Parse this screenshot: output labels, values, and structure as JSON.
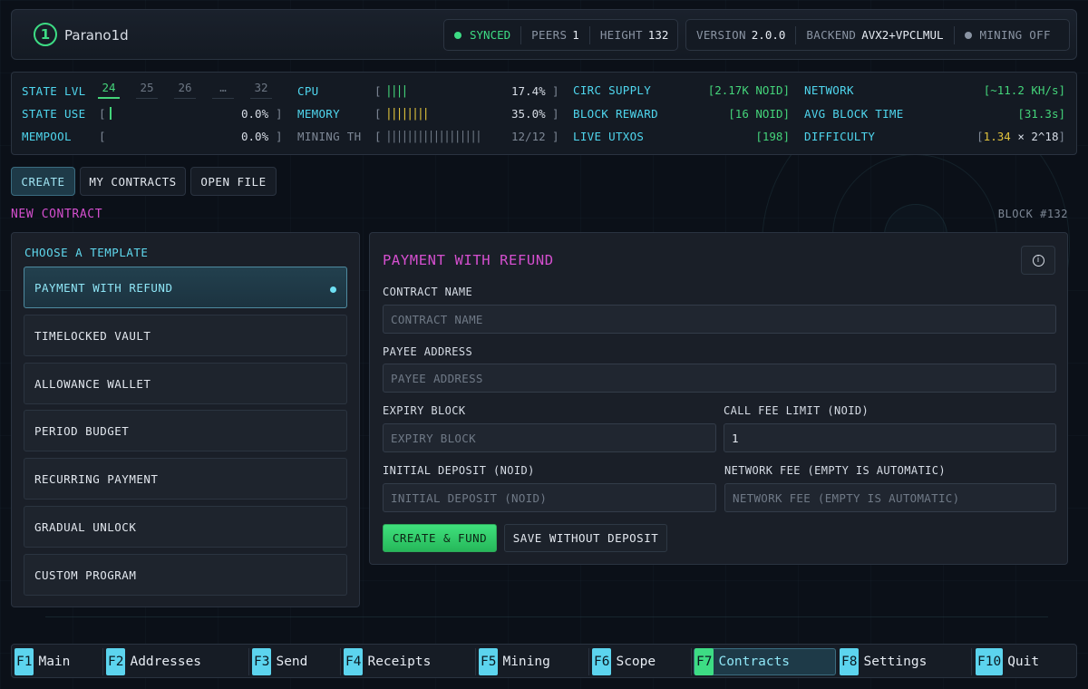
{
  "header": {
    "app_name": "Parano1d",
    "logo_glyph": "1",
    "sync_status": "SYNCED",
    "peers_label": "PEERS",
    "peers_value": "1",
    "height_label": "HEIGHT",
    "height_value": "132",
    "version_label": "VERSION",
    "version_value": "2.0.0",
    "backend_label": "BACKEND",
    "backend_value": "AVX2+VPCLMUL",
    "mining_status": "MINING OFF",
    "colors": {
      "synced": "#3ddc84",
      "mining_off": "#8a94a3"
    }
  },
  "stats": {
    "state_lvl_label": "STATE LVL",
    "state_levels": [
      "24",
      "25",
      "26",
      "…",
      "32"
    ],
    "state_use_label": "STATE USE",
    "state_use_value": "0.0%",
    "mempool_label": "MEMPOOL",
    "mempool_value": "0.0%",
    "cpu_label": "CPU",
    "cpu_bars": "||||",
    "cpu_value": "17.4%",
    "memory_label": "MEMORY",
    "memory_bars": "||||||||",
    "memory_value": "35.0%",
    "mining_th_label": "MINING TH",
    "mining_th_bars": "||||||||||||||||||",
    "mining_th_value": "12/12",
    "circ_supply_label": "CIRC SUPPLY",
    "circ_supply_value": "[2.17K NOID]",
    "block_reward_label": "BLOCK REWARD",
    "block_reward_value": "[16 NOID]",
    "live_utxos_label": "LIVE UTXOS",
    "live_utxos_value": "[198]",
    "network_label": "NETWORK",
    "network_value": "[~11.2 KH/s]",
    "avg_block_time_label": "AVG BLOCK TIME",
    "avg_block_time_value": "[31.3s]",
    "difficulty_label": "DIFFICULTY",
    "difficulty_mantissa": "1.34",
    "difficulty_exp": "× 2^18",
    "colors": {
      "cpu_bar": "#44d47a",
      "memory_bar": "#e0c23c",
      "mining_bar": "#6c7683",
      "label": "#4fd6ee"
    }
  },
  "tabs": [
    {
      "label": "CREATE"
    },
    {
      "label": "MY CONTRACTS"
    },
    {
      "label": "OPEN FILE"
    }
  ],
  "section": {
    "title": "NEW CONTRACT",
    "block": "BLOCK #132"
  },
  "templates": {
    "title": "CHOOSE A TEMPLATE",
    "items": [
      "PAYMENT WITH REFUND",
      "TIMELOCKED VAULT",
      "ALLOWANCE WALLET",
      "PERIOD BUDGET",
      "RECURRING PAYMENT",
      "GRADUAL UNLOCK",
      "CUSTOM PROGRAM"
    ],
    "selected": "PAYMENT WITH REFUND"
  },
  "form": {
    "title": "PAYMENT WITH REFUND",
    "info_icon": "info-icon",
    "contract_name_label": "CONTRACT NAME",
    "contract_name_placeholder": "CONTRACT NAME",
    "payee_label": "PAYEE ADDRESS",
    "payee_placeholder": "PAYEE ADDRESS",
    "expiry_label": "EXPIRY BLOCK",
    "expiry_placeholder": "EXPIRY BLOCK",
    "call_fee_label": "CALL FEE LIMIT (NOID)",
    "call_fee_value": "1",
    "deposit_label": "INITIAL DEPOSIT (NOID)",
    "deposit_placeholder": "INITIAL DEPOSIT (NOID)",
    "network_fee_label": "NETWORK FEE (EMPTY IS AUTOMATIC)",
    "network_fee_placeholder": "NETWORK FEE (EMPTY IS AUTOMATIC)",
    "create_button": "CREATE & FUND",
    "save_button": "SAVE WITHOUT DEPOSIT",
    "colors": {
      "title": "#d54fcf",
      "create_button": "#3fe07c"
    }
  },
  "fkeys": [
    {
      "key": "F1",
      "label": "Main"
    },
    {
      "key": "F2",
      "label": "Addresses"
    },
    {
      "key": "F3",
      "label": "Send"
    },
    {
      "key": "F4",
      "label": "Receipts"
    },
    {
      "key": "F5",
      "label": "Mining"
    },
    {
      "key": "F6",
      "label": "Scope"
    },
    {
      "key": "F7",
      "label": "Contracts"
    },
    {
      "key": "F8",
      "label": "Settings"
    },
    {
      "key": "F10",
      "label": "Quit"
    }
  ],
  "active_fkey": "F7"
}
